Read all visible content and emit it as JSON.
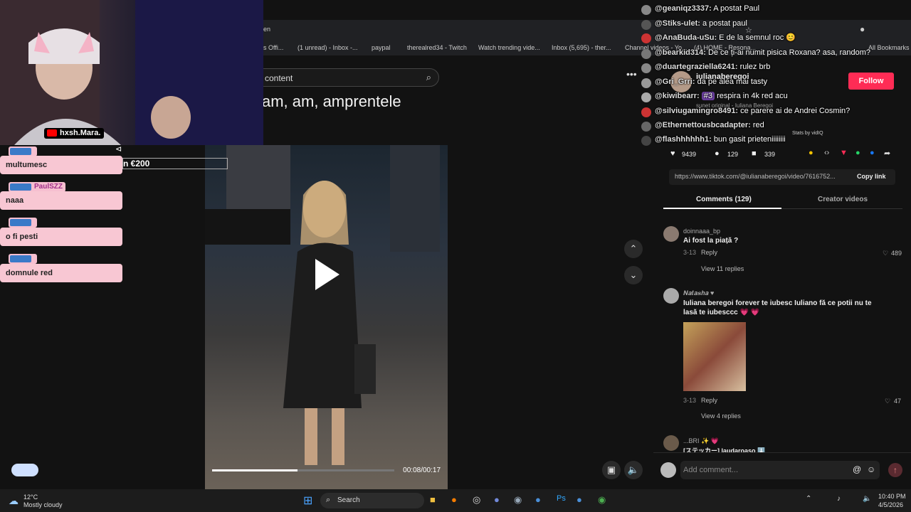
{
  "browser": {
    "tab_fragment": "en",
    "bookmarks": [
      {
        "label": "s Offi..."
      },
      {
        "label": "(1 unread) - Inbox -..."
      },
      {
        "label": "paypal"
      },
      {
        "label": "therealred34 - Twitch"
      },
      {
        "label": "Watch trending vide..."
      },
      {
        "label": "Inbox (5,695) - ther..."
      },
      {
        "label": "Channel videos - Yo..."
      },
      {
        "label": "(4) HOME - Resona..."
      },
      {
        "label": "All Bookmarks"
      }
    ]
  },
  "search": {
    "placeholder": "content"
  },
  "video": {
    "overlay_caption": "am, am, amprentele",
    "time": "00:08/00:17",
    "progress": 0.47
  },
  "post": {
    "author": "iulianaberegoi",
    "sound": "sunet original - Iuliana Beregoi",
    "follow_label": "Follow",
    "likes": "9439",
    "comments": "129",
    "saves": "339",
    "link": "https://www.tiktok.com/@iulianaberegoi/video/7616752...",
    "copy_label": "Copy link",
    "stats_label": "Stats by vidIQ"
  },
  "tabs": {
    "comments": "Comments (129)",
    "creator": "Creator videos"
  },
  "comments": [
    {
      "user": "doinnaaa_bp",
      "text": "Ai fost la piață ?",
      "date": "3-13",
      "reply": "Reply",
      "likes": "489",
      "replies": "View 11 replies"
    },
    {
      "user": "𝑵𝒂𝒕𝒂𝒔𝒉𝒂 ♥",
      "text": "Iuliana beregoi forever te iubesc Iuliano fă ce potii nu te lasă te iubesccc 💗 💗",
      "date": "3-13",
      "reply": "Reply",
      "likes": "47",
      "replies": "View 4 replies"
    },
    {
      "user": "...BRI ✨ 💗",
      "text": "[ステッカー] laudaroaso ⬇️"
    }
  ],
  "add_comment": {
    "placeholder": "Add comment..."
  },
  "stream": {
    "streamer": "hxsh.Mara.",
    "donation": "n €200",
    "chat": [
      {
        "user": "",
        "message": "multumesc"
      },
      {
        "user": "PaulSZZ",
        "message": "naaa"
      },
      {
        "user": "",
        "message": "o fi pesti"
      },
      {
        "user": "",
        "message": "domnule red"
      }
    ],
    "overlay_chat": [
      {
        "user": "@geaniqz3337:",
        "message": "A postat Paul",
        "color": "#888"
      },
      {
        "user": "@Stiks-ulet:",
        "message": "a postat paul",
        "color": "#555"
      },
      {
        "user": "@AnaBuda-uSu:",
        "message": "E de la semnul roc 😊",
        "color": "#c33"
      },
      {
        "user": "@bearkid314:",
        "message": "De ce ți-ai numit pisica Roxana? asa, random?",
        "color": "#777"
      },
      {
        "user": "@duartegraziella6241:",
        "message": "rulez brb",
        "color": "#888"
      },
      {
        "user": "@Gri_Grri:",
        "message": "da pe alea mai tasty",
        "color": "#999"
      },
      {
        "user": "@kiwibearr:",
        "message": "respira in 4k red acu",
        "badge": "#3",
        "color": "#aaa"
      },
      {
        "user": "@silviugamingro8491:",
        "message": "ce parere ai de Andrei Cosmin?",
        "color": "#c33"
      },
      {
        "user": "@Ethernettousbcadapter:",
        "message": "red",
        "color": "#666"
      },
      {
        "user": "@flashhhhhh1:",
        "message": "bun gasit prieteniiiiiiii",
        "color": "#444"
      }
    ]
  },
  "taskbar": {
    "temp": "12°C",
    "weather": "Mostly cloudy",
    "search": "Search",
    "time": "10:40 PM",
    "date": "4/5/2026"
  }
}
